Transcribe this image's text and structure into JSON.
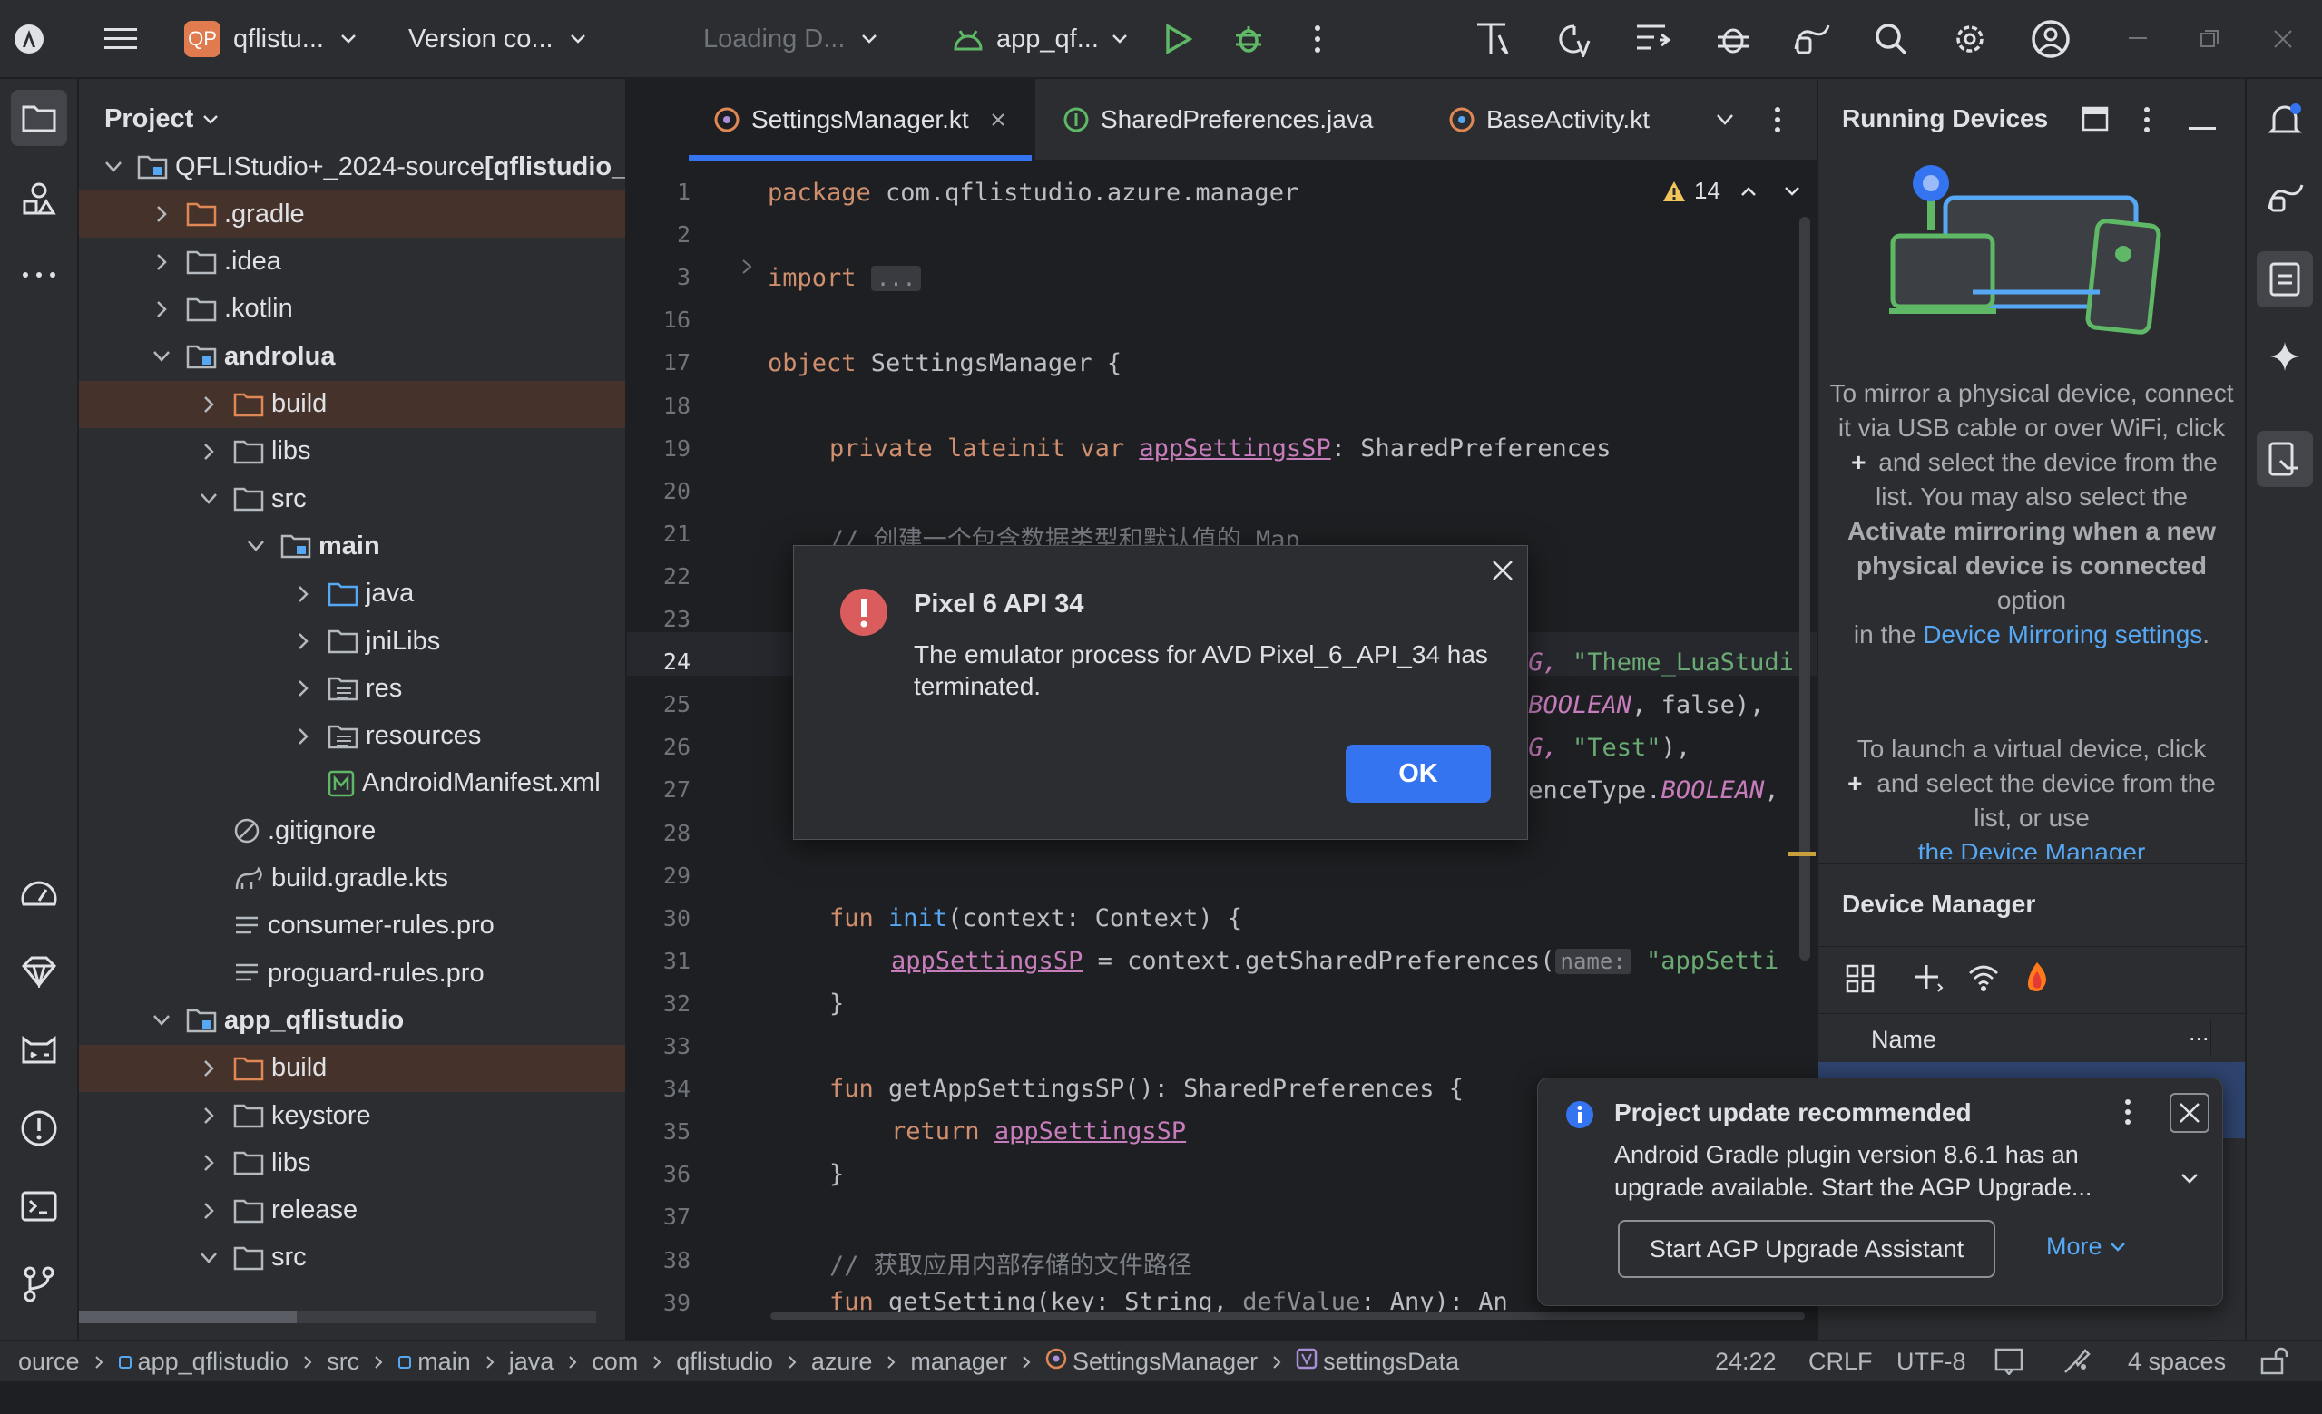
{
  "titlebar": {
    "project_badge": "QP",
    "project_name": "qflistu...",
    "vcs": "Version co...",
    "loading": "Loading D...",
    "run_config": "app_qf..."
  },
  "project_panel": {
    "title": "Project",
    "rows": [
      {
        "label": "QFLIStudio+_2024-source",
        "extra": " [qflistudio_p"
      },
      {
        "label": ".gradle"
      },
      {
        "label": ".idea"
      },
      {
        "label": ".kotlin"
      },
      {
        "label": "androlua"
      },
      {
        "label": "build"
      },
      {
        "label": "libs"
      },
      {
        "label": "src"
      },
      {
        "label": "main"
      },
      {
        "label": "java"
      },
      {
        "label": "jniLibs"
      },
      {
        "label": "res"
      },
      {
        "label": "resources"
      },
      {
        "label": "AndroidManifest.xml"
      },
      {
        "label": ".gitignore"
      },
      {
        "label": "build.gradle.kts"
      },
      {
        "label": "consumer-rules.pro"
      },
      {
        "label": "proguard-rules.pro"
      },
      {
        "label": "app_qflistudio"
      },
      {
        "label": "build"
      },
      {
        "label": "keystore"
      },
      {
        "label": "libs"
      },
      {
        "label": "release"
      },
      {
        "label": "src"
      }
    ]
  },
  "editor": {
    "tabs": [
      "SettingsManager.kt",
      "SharedPreferences.java",
      "BaseActivity.kt"
    ],
    "warnings": "14",
    "line_numbers": [
      "1",
      "2",
      "3",
      "16",
      "17",
      "18",
      "19",
      "20",
      "21",
      "22",
      "23",
      "24",
      "25",
      "26",
      "27",
      "28",
      "29",
      "30",
      "31",
      "32",
      "33",
      "34",
      "35",
      "36",
      "37",
      "38",
      "39"
    ],
    "code": {
      "l1_kw": "package",
      "l1_rest": " com.qflistudio.azure.manager",
      "l3_kw": "import",
      "l3_fold": "...",
      "l17_kw": "object",
      "l17_rest": " SettingsManager {",
      "l19_kw": "private lateinit var",
      "l19_prop": "appSettingsSP",
      "l19_rest": ": SharedPreferences",
      "l21_cm": "// 创建一个包含数据类型和默认值的 Map",
      "l24_a": "NG, ",
      "l24_str": "\"Theme_LuaStudi",
      "l25_dot": ".",
      "l25_it": "BOOLEAN",
      "l25_rest": ", false),",
      "l26_a": "NG, ",
      "l26_str": "\"Test\"",
      "l26_rest": "),",
      "l27_a": "renceType.",
      "l27_it": "BOOLEAN",
      "l27_rest": ",",
      "l30_kw": "fun",
      "l30_fn": "init",
      "l30_rest": "(context: Context) {",
      "l31_prop": "appSettingsSP",
      "l31_rest": " = context.getSharedPreferences(",
      "l31_hint": "name:",
      "l31_str": "\"appSetti",
      "l32": "}",
      "l34_kw": "fun",
      "l34_fn": "getAppSettingsSP",
      "l34_rest": "(): SharedPreferences {",
      "l35_kw": "return",
      "l35_prop": "appSettingsSP",
      "l36": "}",
      "l38_cm": "// 获取应用内部存储的文件路径",
      "l39_kw": "fun",
      "l39_fn": "getSetting",
      "l39_rest": "(key: String, ",
      "l39_dim": "defValue",
      "l39_rest2": ": Any): An"
    }
  },
  "dialog": {
    "title": "Pixel 6 API 34",
    "message": "The emulator process for AVD Pixel_6_API_34 has terminated.",
    "ok": "OK"
  },
  "running_devices": {
    "title": "Running Devices",
    "p1a": "To mirror a physical device, connect it via USB cable or over WiFi, click",
    "p1b": "and select the device from the list. You may also select the",
    "p1c": "Activate mirroring when a new physical device is connected",
    "p1d": "option",
    "p1e": "in the",
    "p1link": "Device Mirroring settings",
    "p1f": ".",
    "p2a": "To launch a virtual device, click",
    "p2b": "and select the device from the list, or use",
    "p2link": "the Device Manager"
  },
  "device_manager": {
    "title": "Device Manager",
    "col_name": "Name",
    "col_more": "..."
  },
  "notification": {
    "title": "Project update recommended",
    "body": "Android Gradle plugin version 8.6.1 has an upgrade available. Start the AGP Upgrade...",
    "action": "Start AGP Upgrade Assistant",
    "more": "More"
  },
  "statusbar": {
    "crumbs": [
      "ource",
      "app_qflistudio",
      "src",
      "main",
      "java",
      "com",
      "qflistudio",
      "azure",
      "manager",
      "SettingsManager",
      "settingsData"
    ],
    "position": "24:22",
    "line_sep": "CRLF",
    "encoding": "UTF-8",
    "indent": "4 spaces"
  },
  "colors": {
    "accent": "#3574f0",
    "selection": "#45322b",
    "error": "#db5c5c",
    "run": "#5fb865"
  }
}
